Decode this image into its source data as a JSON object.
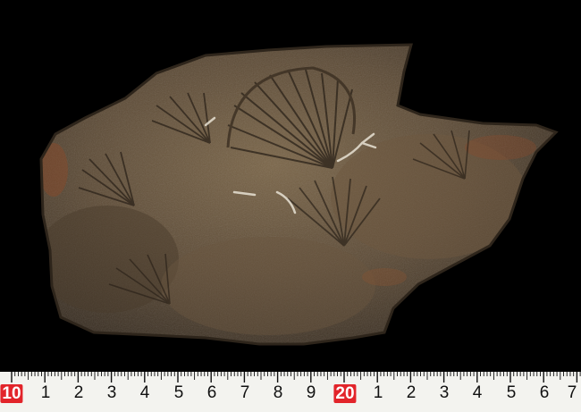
{
  "photo": {
    "subject": "fossil-rock-slab",
    "background_color": "#000000",
    "rock_colors": [
      "#5b4a36",
      "#6e5a42",
      "#3e3226",
      "#8a7352"
    ]
  },
  "ruler": {
    "labels": [
      "10",
      "1",
      "2",
      "3",
      "4",
      "5",
      "6",
      "7",
      "8",
      "9",
      "20",
      "1",
      "2",
      "3",
      "4",
      "5",
      "6",
      "7"
    ],
    "highlighted": [
      "10",
      "20"
    ],
    "highlight_color": "#e2242a",
    "unit_color": "#111111",
    "background_color": "#f3f3ef"
  }
}
